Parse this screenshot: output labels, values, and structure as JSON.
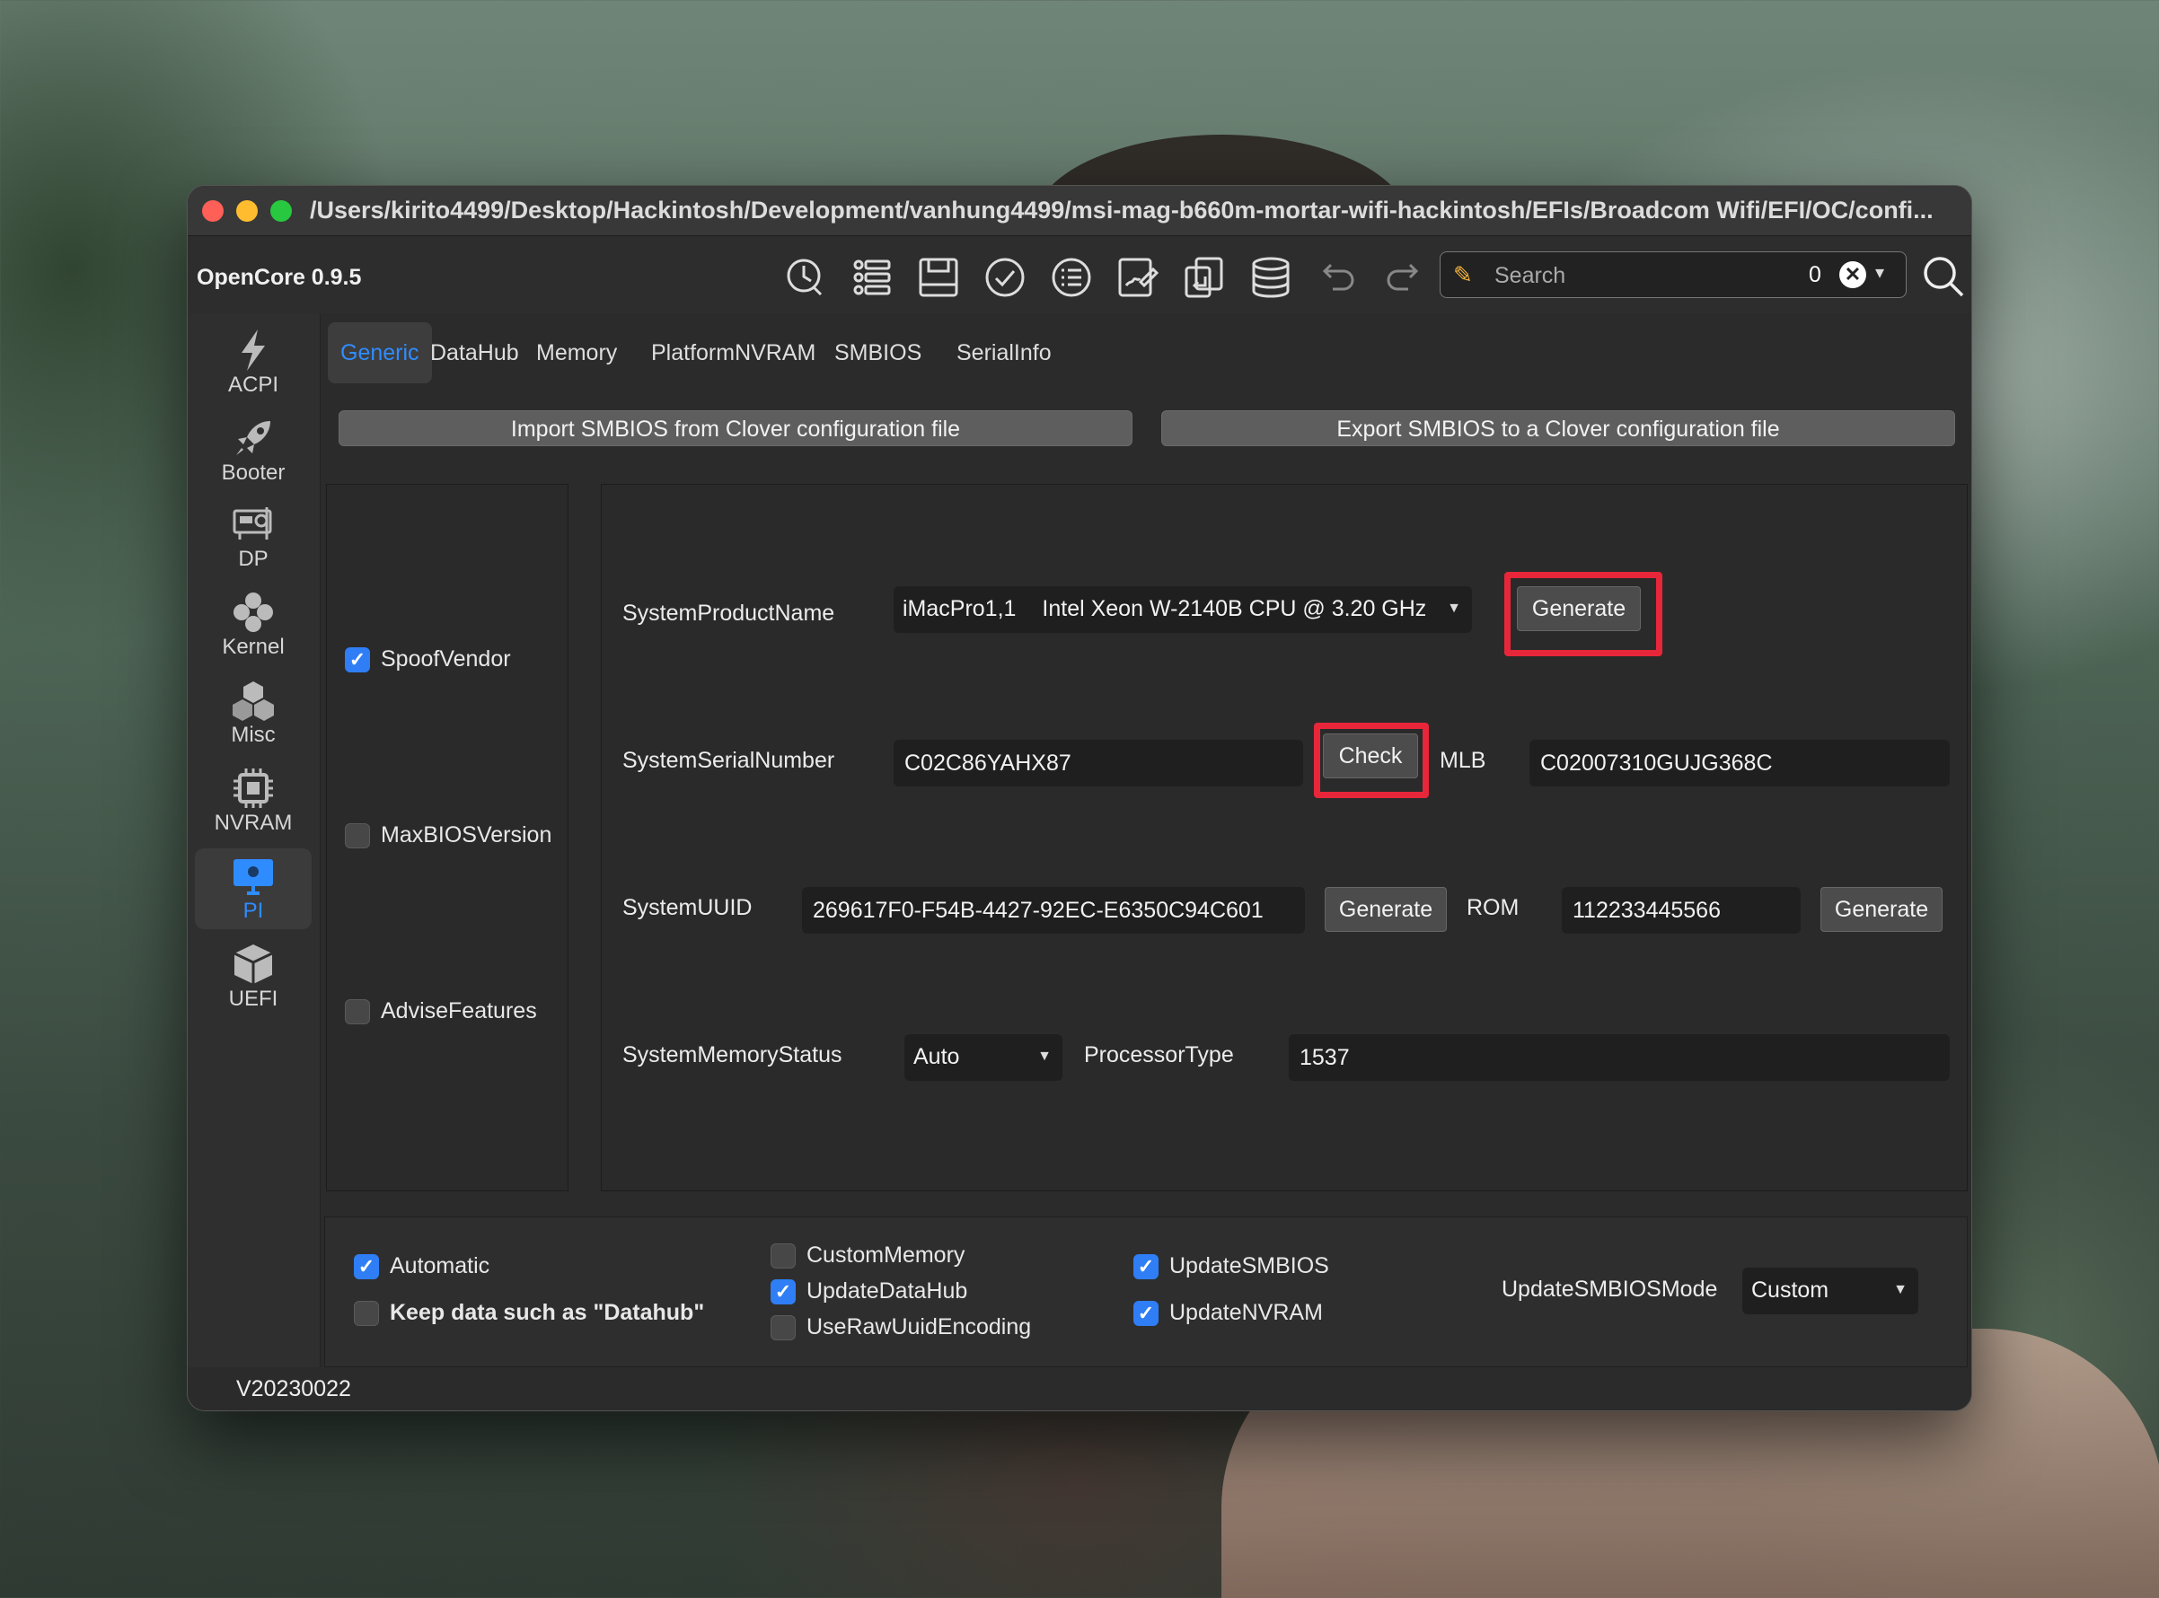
{
  "window": {
    "title": "/Users/kirito4499/Desktop/Hackintosh/Development/vanhung4499/msi-mag-b660m-mortar-wifi-hackintosh/EFIs/Broadcom Wifi/EFI/OC/confi...",
    "app_version": "OpenCore 0.9.5",
    "status_version": "V20230022"
  },
  "toolbar": {
    "icons": [
      "history-icon",
      "list-icon",
      "save-icon",
      "check-circle-icon",
      "text-list-icon",
      "signature-icon",
      "import-icon",
      "database-icon",
      "undo-icon",
      "redo-icon"
    ],
    "search_placeholder": "Search",
    "search_count": "0",
    "clear_glyph": "✕",
    "dropdown_glyph": "▾"
  },
  "sidebar": {
    "items": [
      {
        "label": "ACPI",
        "icon": "bolt-icon"
      },
      {
        "label": "Booter",
        "icon": "rocket-icon"
      },
      {
        "label": "DP",
        "icon": "graphics-card-icon"
      },
      {
        "label": "Kernel",
        "icon": "kernel-icon"
      },
      {
        "label": "Misc",
        "icon": "cubes-icon"
      },
      {
        "label": "NVRAM",
        "icon": "chip-icon"
      },
      {
        "label": "PI",
        "icon": "monitor-icon",
        "active": true
      },
      {
        "label": "UEFI",
        "icon": "box-icon"
      }
    ]
  },
  "tabs": [
    "Generic",
    "DataHub",
    "Memory",
    "PlatformNVRAM",
    "SMBIOS",
    "SerialInfo"
  ],
  "actions": {
    "import": "Import SMBIOS from Clover configuration file",
    "export": "Export SMBIOS to a Clover configuration file"
  },
  "left_panel": {
    "spoof_vendor": {
      "label": "SpoofVendor",
      "checked": true
    },
    "max_bios_version": {
      "label": "MaxBIOSVersion",
      "checked": false
    },
    "advise_features": {
      "label": "AdviseFeatures",
      "checked": false
    }
  },
  "form": {
    "system_product_name": {
      "label": "SystemProductName",
      "model": "iMacPro1,1",
      "cpu": "Intel Xeon W-2140B CPU @ 3.20 GHz",
      "button": "Generate"
    },
    "system_serial_number": {
      "label": "SystemSerialNumber",
      "value": "C02C86YAHX87",
      "button": "Check"
    },
    "mlb": {
      "label": "MLB",
      "value": "C02007310GUJG368C"
    },
    "system_uuid": {
      "label": "SystemUUID",
      "value": "269617F0-F54B-4427-92EC-E6350C94C601",
      "button": "Generate"
    },
    "rom": {
      "label": "ROM",
      "value": "112233445566",
      "button": "Generate"
    },
    "system_memory_status": {
      "label": "SystemMemoryStatus",
      "value": "Auto"
    },
    "processor_type": {
      "label": "ProcessorType",
      "value": "1537"
    }
  },
  "bottom": {
    "automatic": {
      "label": "Automatic",
      "checked": true
    },
    "keep_data": {
      "label": "Keep data such as \"Datahub\"",
      "checked": false
    },
    "custom_memory": {
      "label": "CustomMemory",
      "checked": false
    },
    "update_datahub": {
      "label": "UpdateDataHub",
      "checked": true
    },
    "use_raw_uuid": {
      "label": "UseRawUuidEncoding",
      "checked": false
    },
    "update_smbios": {
      "label": "UpdateSMBIOS",
      "checked": true
    },
    "update_nvram": {
      "label": "UpdateNVRAM",
      "checked": true
    },
    "update_smbios_mode": {
      "label": "UpdateSMBIOSMode",
      "value": "Custom"
    }
  },
  "colors": {
    "accent": "#2f8cff",
    "highlight": "#e8263a",
    "checkbox_on": "#2f7ef5"
  }
}
